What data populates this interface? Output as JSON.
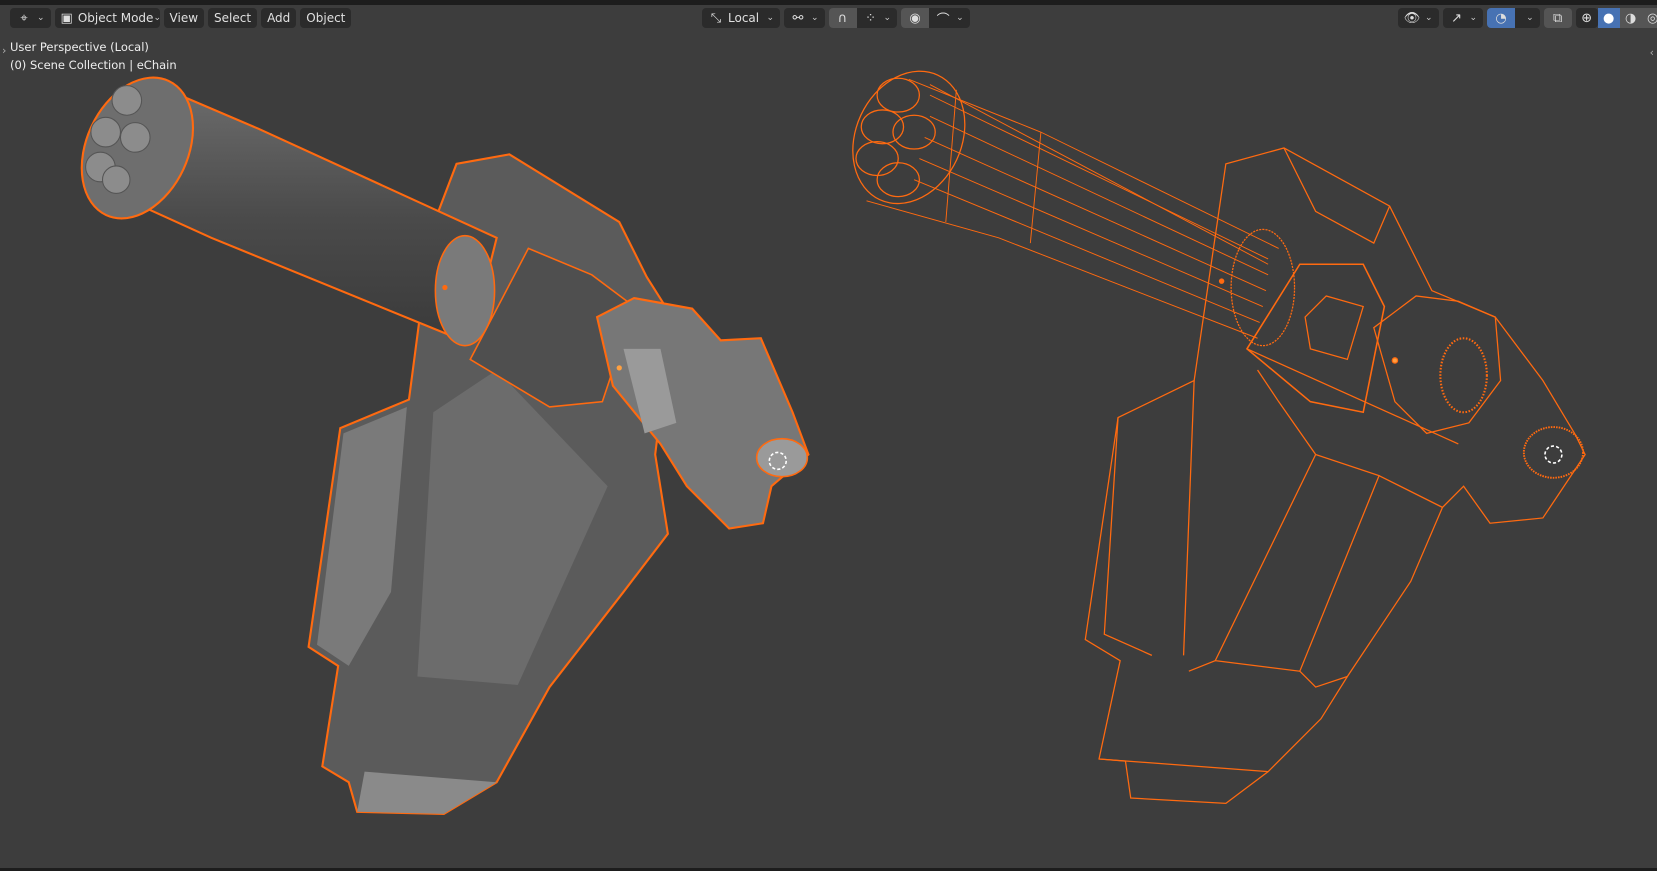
{
  "header": {
    "editor_type_icon": "viewport-icon",
    "mode": "Object Mode",
    "menus": [
      "View",
      "Select",
      "Add",
      "Object"
    ],
    "transform_orientation": "Local",
    "pivot_icon": "pivot-icon",
    "snap_icon": "magnet-icon",
    "snap_target_icon": "grid-snap-icon",
    "proportional_icon": "proportional-icon",
    "falloff_icon": "falloff-curve-icon",
    "visibility_icon": "eye-icon",
    "gizmo_icon": "gizmo-icon",
    "overlays_icon": "overlays-icon",
    "xray_icon": "xray-icon",
    "shading_modes": [
      "wireframe",
      "solid",
      "material",
      "rendered"
    ],
    "active_shading": "solid"
  },
  "viewport": {
    "perspective_label": "User Perspective (Local)",
    "collection_label": "(0) Scene Collection | eChain",
    "selection_color": "#ff7a1a",
    "background_color": "#3d3d3d"
  }
}
